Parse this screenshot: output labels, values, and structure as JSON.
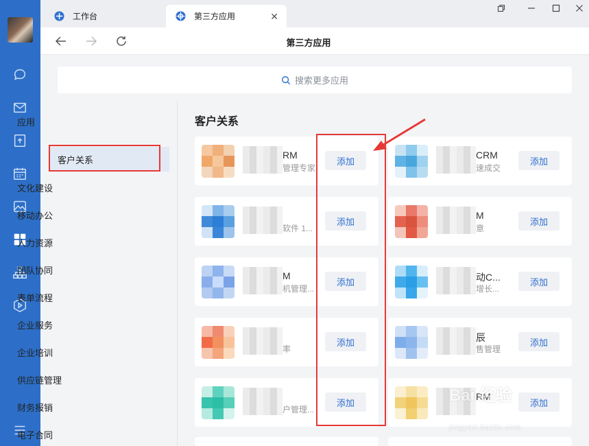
{
  "tabs": [
    {
      "label": "工作台"
    },
    {
      "label": "第三方应用"
    }
  ],
  "nav": {
    "title": "第三方应用"
  },
  "search": {
    "placeholder": "搜索更多应用"
  },
  "categories": [
    {
      "label": "应用"
    },
    {
      "label": "客户关系"
    },
    {
      "label": "文化建设"
    },
    {
      "label": "移动办公"
    },
    {
      "label": "人力资源"
    },
    {
      "label": "团队协同"
    },
    {
      "label": "表单流程"
    },
    {
      "label": "企业服务"
    },
    {
      "label": "企业培训"
    },
    {
      "label": "供应链管理"
    },
    {
      "label": "财务报销"
    },
    {
      "label": "电子合同"
    }
  ],
  "section": {
    "title": "客户关系"
  },
  "apps": [
    {
      "name": "RM",
      "desc": "管理专家",
      "add": "添加",
      "colors": [
        "#f5c8a2",
        "#f0b07a",
        "#f3d0b0",
        "#f0a868",
        "#f6c79c",
        "#e8955a",
        "#f2d6bd",
        "#f1b989",
        "#f7dcc4"
      ]
    },
    {
      "name": "CRM",
      "desc": "速成交",
      "add": "添加",
      "colors": [
        "#c7e3f3",
        "#8fcbed",
        "#d9eef8",
        "#5fb3e4",
        "#4aa7dd",
        "#9ed2ef",
        "#e3f1f9",
        "#7fc2ea",
        "#b7dcf2"
      ]
    },
    {
      "name": "",
      "desc": "软件 1...",
      "add": "添加",
      "colors": [
        "#d3e6f7",
        "#7fb4e8",
        "#a9cdef",
        "#3f8ad9",
        "#2d7ed6",
        "#5a9fe0",
        "#cfe2f6",
        "#3b86d8",
        "#9cc4ec"
      ]
    },
    {
      "name": "M",
      "desc": "意",
      "add": "添加",
      "colors": [
        "#f7c9bd",
        "#e9786b",
        "#f4b3a6",
        "#e4634f",
        "#d9543f",
        "#ee8d7b",
        "#f3c4b8",
        "#e05a44",
        "#f1a796"
      ]
    },
    {
      "name": "M",
      "desc": "机管理...",
      "add": "添加",
      "colors": [
        "#bcd2f3",
        "#8fb3ec",
        "#c8daf5",
        "#8aaeeb",
        "#c9dcfb",
        "#7aa3e8",
        "#b3cbf1",
        "#93b6ed",
        "#c2d6f4"
      ]
    },
    {
      "name": "动C...",
      "desc": "增长...",
      "add": "添加",
      "colors": [
        "#aedcf6",
        "#52b6ee",
        "#d7edfa",
        "#3faaea",
        "#2a9fe6",
        "#66c0f0",
        "#bfe3f8",
        "#38a6e9",
        "#e5f3fb"
      ]
    },
    {
      "name": "",
      "desc": "率",
      "add": "添加",
      "colors": [
        "#f7b9a6",
        "#f08a6e",
        "#f9d0b9",
        "#f26b48",
        "#f2905f",
        "#f8c29b",
        "#f6c5ad",
        "#f4a57c",
        "#fbd9bd"
      ]
    },
    {
      "name": "辰",
      "desc": "售管理",
      "add": "添加",
      "colors": [
        "#cfe0f7",
        "#a6c7f1",
        "#d7e6f8",
        "#7eaeea",
        "#8bb5ec",
        "#c4dbf6",
        "#dce8f8",
        "#a1c2ef",
        "#e3edf9"
      ]
    },
    {
      "name": "",
      "desc": "户管理...",
      "add": "添加",
      "colors": [
        "#c4eee6",
        "#5fd2bf",
        "#a9e6da",
        "#36c4ad",
        "#2dbfa6",
        "#58cfb9",
        "#b5eadf",
        "#46c9b3",
        "#d4f3ed"
      ]
    },
    {
      "name": "RM",
      "desc": "",
      "add": "添加",
      "colors": [
        "#faf0d0",
        "#f6e0a2",
        "#fbecc3",
        "#f3d27c",
        "#efc55d",
        "#f6dc93",
        "#fbf1d4",
        "#f2cf71",
        "#fae9bb"
      ]
    }
  ],
  "watermark": {
    "brand": "Bai 经验",
    "site": "jingyan.baidu.com"
  }
}
